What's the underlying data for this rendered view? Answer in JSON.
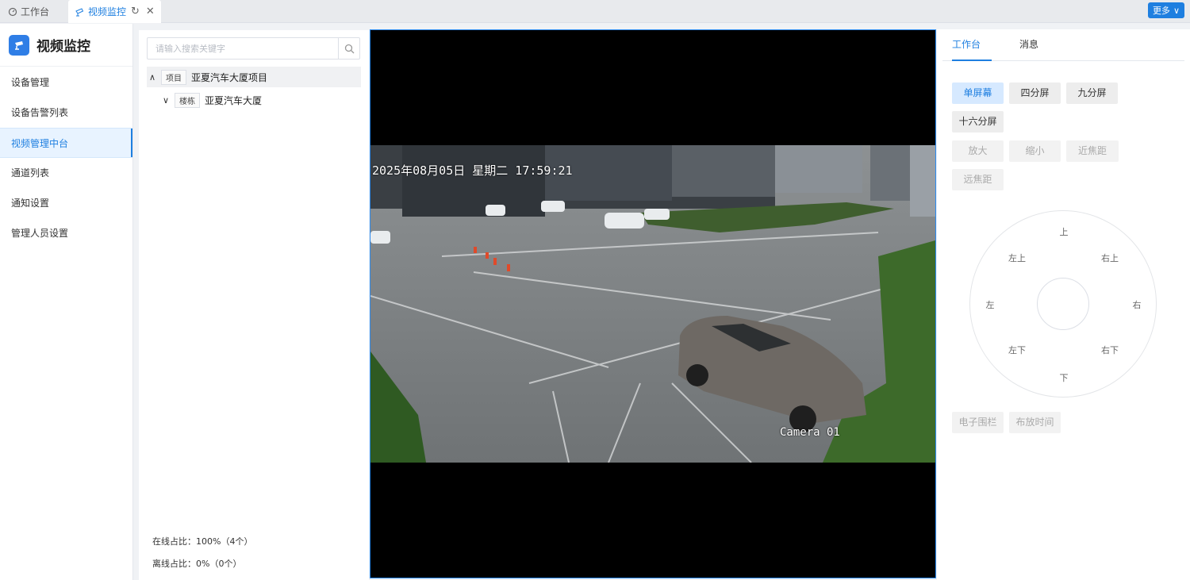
{
  "tabs": [
    {
      "label": "工作台"
    },
    {
      "label": "视频监控"
    }
  ],
  "more_label": "更多",
  "brand": {
    "title": "视频监控"
  },
  "nav": [
    {
      "label": "设备管理"
    },
    {
      "label": "设备告警列表"
    },
    {
      "label": "视频管理中台"
    },
    {
      "label": "通道列表"
    },
    {
      "label": "通知设置"
    },
    {
      "label": "管理人员设置"
    }
  ],
  "search": {
    "placeholder": "请输入搜索关键字"
  },
  "tree": [
    {
      "tag": "项目",
      "label": "亚夏汽车大厦项目",
      "chevron": "∧"
    },
    {
      "tag": "楼栋",
      "label": "亚夏汽车大厦",
      "chevron": "∨"
    }
  ],
  "stats": {
    "online": "在线占比：100%（4个）",
    "offline": "离线占比：0%（0个）"
  },
  "video": {
    "timestamp": "2025年08月05日 星期二 17:59:21",
    "camera": "Camera 01"
  },
  "right_tabs": [
    {
      "label": "工作台"
    },
    {
      "label": "消息"
    }
  ],
  "screen_buttons": [
    {
      "label": "单屏幕"
    },
    {
      "label": "四分屏"
    },
    {
      "label": "九分屏"
    },
    {
      "label": "十六分屏"
    }
  ],
  "zoom_buttons": [
    {
      "label": "放大"
    },
    {
      "label": "缩小"
    },
    {
      "label": "近焦距"
    },
    {
      "label": "远焦距"
    }
  ],
  "directions": {
    "up": "上",
    "up_left": "左上",
    "up_right": "右上",
    "left": "左",
    "right": "右",
    "down_left": "左下",
    "down_right": "右下",
    "down": "下"
  },
  "bottom_buttons": [
    {
      "label": "电子围栏"
    },
    {
      "label": "布放时间"
    }
  ],
  "colors": {
    "accent": "#1e7fe0",
    "active_bg": "#e8f3ff"
  }
}
